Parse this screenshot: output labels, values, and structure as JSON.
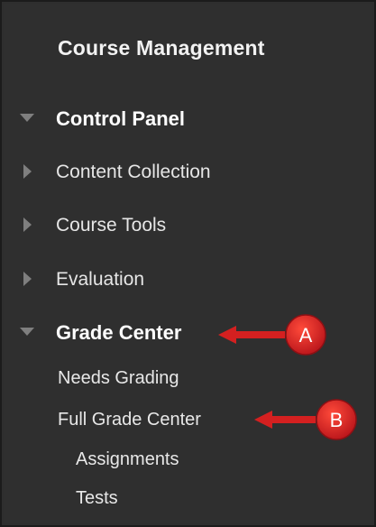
{
  "panel": {
    "title": "Course Management"
  },
  "nav": {
    "control_panel": "Control Panel",
    "content_collection": "Content Collection",
    "course_tools": "Course Tools",
    "evaluation": "Evaluation",
    "grade_center": "Grade Center"
  },
  "grade_center_links": {
    "needs_grading": "Needs Grading",
    "full_grade_center": "Full Grade Center",
    "assignments": "Assignments",
    "tests": "Tests"
  },
  "annotations": {
    "a": "A",
    "b": "B",
    "color": "#d42020"
  },
  "icons": {
    "expanded": "triangle-down-icon",
    "collapsed": "triangle-right-icon"
  }
}
